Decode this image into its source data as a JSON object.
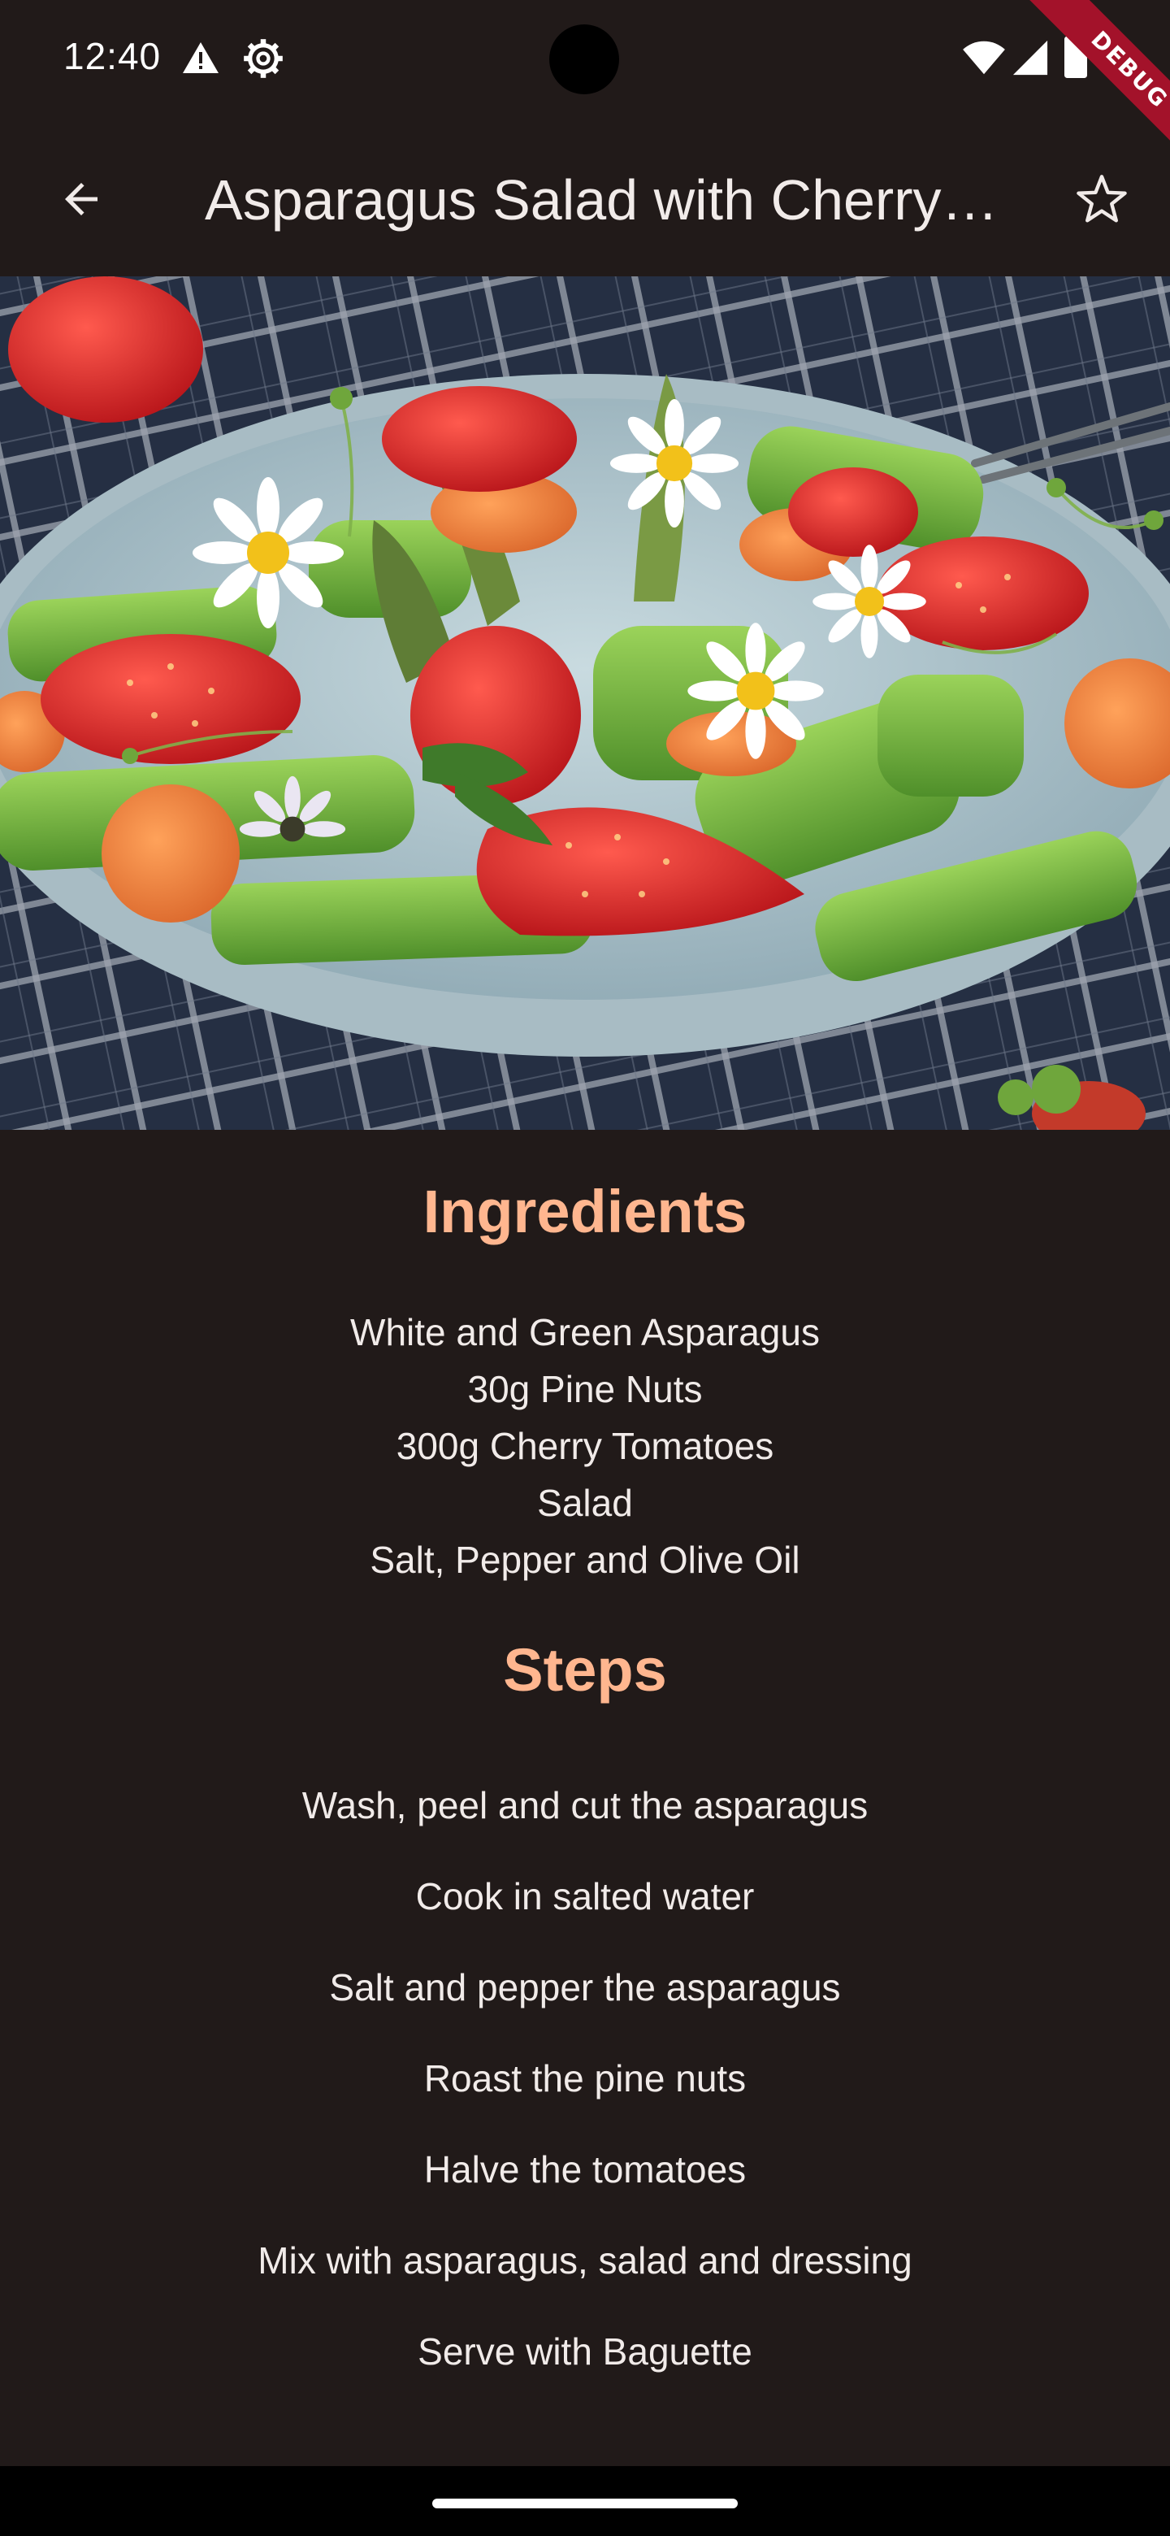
{
  "status_bar": {
    "time": "12:40",
    "icons": [
      "alert-icon",
      "settings-gear-icon",
      "wifi-icon",
      "signal-icon",
      "battery-icon"
    ]
  },
  "debug_banner": {
    "label": "DEBUG"
  },
  "app_bar": {
    "title": "Asparagus Salad with Cherry Tomatoes",
    "back_icon": "arrow-back-icon",
    "favorite_icon": "star-outline-icon"
  },
  "hero_image": {
    "subject": "asparagus-strawberry-salad-photo"
  },
  "ingredients": {
    "title": "Ingredients",
    "items": [
      "White and Green Asparagus",
      "30g Pine Nuts",
      "300g Cherry Tomatoes",
      "Salad",
      "Salt, Pepper and Olive Oil"
    ]
  },
  "steps": {
    "title": "Steps",
    "items": [
      "Wash, peel and cut the asparagus",
      "Cook in salted water",
      "Salt and pepper the asparagus",
      "Roast the pine nuts",
      "Halve the tomatoes",
      "Mix with asparagus, salad and dressing",
      "Serve with Baguette"
    ]
  },
  "colors": {
    "background": "#211a19",
    "accent": "#ffb68f",
    "text": "#f1ebe9",
    "debug_banner": "#a3122a"
  }
}
